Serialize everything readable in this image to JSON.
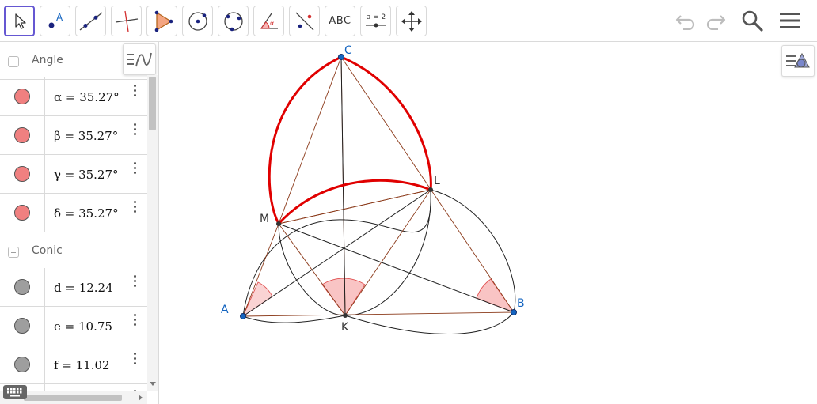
{
  "toolbar": {
    "tools": [
      {
        "name": "move-tool",
        "active": true
      },
      {
        "name": "point-tool",
        "glyph": "A"
      },
      {
        "name": "line-tool"
      },
      {
        "name": "perpendicular-line-tool"
      },
      {
        "name": "polygon-tool"
      },
      {
        "name": "circle-center-point-tool"
      },
      {
        "name": "circle-three-points-tool"
      },
      {
        "name": "angle-tool",
        "glyph": "α"
      },
      {
        "name": "reflect-tool"
      },
      {
        "name": "text-tool",
        "label": "ABC"
      },
      {
        "name": "slider-tool",
        "label": "a = 2"
      },
      {
        "name": "move-graphics-view-tool"
      }
    ],
    "right_icons": [
      "undo-icon",
      "redo-icon",
      "search-icon",
      "menu-icon"
    ]
  },
  "algebra": {
    "groups": [
      {
        "label": "Angle",
        "items": [
          {
            "expr": "α = 35.27°",
            "color": "#f08080"
          },
          {
            "expr": "β = 35.27°",
            "color": "#f08080"
          },
          {
            "expr": "γ = 35.27°",
            "color": "#f08080"
          },
          {
            "expr": "δ = 35.27°",
            "color": "#f08080"
          }
        ]
      },
      {
        "label": "Conic",
        "items": [
          {
            "expr": "d = 12.24",
            "color": "#9e9e9e"
          },
          {
            "expr": "e = 10.75",
            "color": "#9e9e9e"
          },
          {
            "expr": "f = 11.02",
            "color": "#9e9e9e"
          }
        ]
      }
    ]
  },
  "graphics": {
    "points": [
      {
        "label": "A"
      },
      {
        "label": "B"
      },
      {
        "label": "C"
      },
      {
        "label": "K"
      },
      {
        "label": "L"
      },
      {
        "label": "M"
      }
    ]
  },
  "colors": {
    "accent": "#6557d2",
    "free_point": "#1565c0",
    "dependent_point": "#333333",
    "arc_red": "#e00000",
    "segment_brown": "#8b3a1a",
    "angle_fill": "#f7b5b5"
  }
}
